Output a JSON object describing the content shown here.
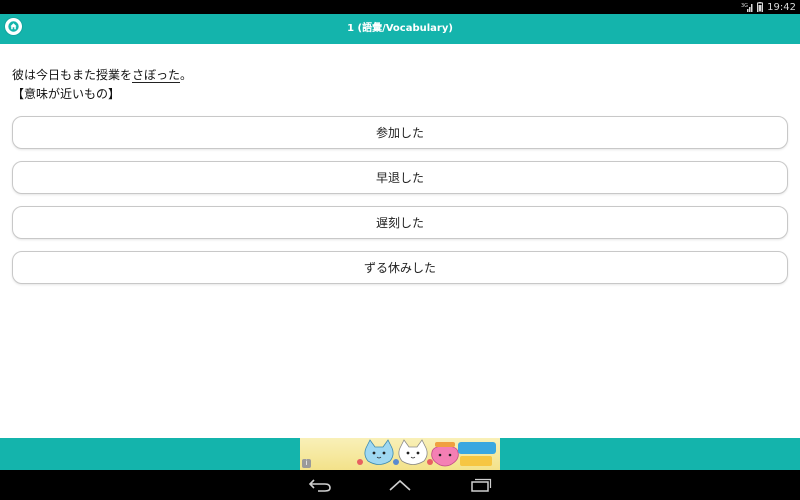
{
  "status_bar": {
    "network": "3G",
    "time": "19:42"
  },
  "header": {
    "title": "1 (語彙/Vocabulary)",
    "home_icon": "home-icon"
  },
  "question": {
    "prefix": "彼は今日もまた授業を",
    "underlined": "さぼった",
    "suffix": "。",
    "instruction": "【意味が近いもの】"
  },
  "choices": [
    {
      "label": "参加した"
    },
    {
      "label": "早退した"
    },
    {
      "label": "遅刻した"
    },
    {
      "label": "ずる休みした"
    }
  ],
  "ad": {
    "info_icon": "info-icon"
  },
  "nav": {
    "back_icon": "back-icon",
    "home_icon": "home-nav-icon",
    "recents_icon": "recent-apps-icon"
  },
  "colors": {
    "accent": "#14b4ac",
    "background": "#ffffff",
    "bars": "#000000"
  }
}
